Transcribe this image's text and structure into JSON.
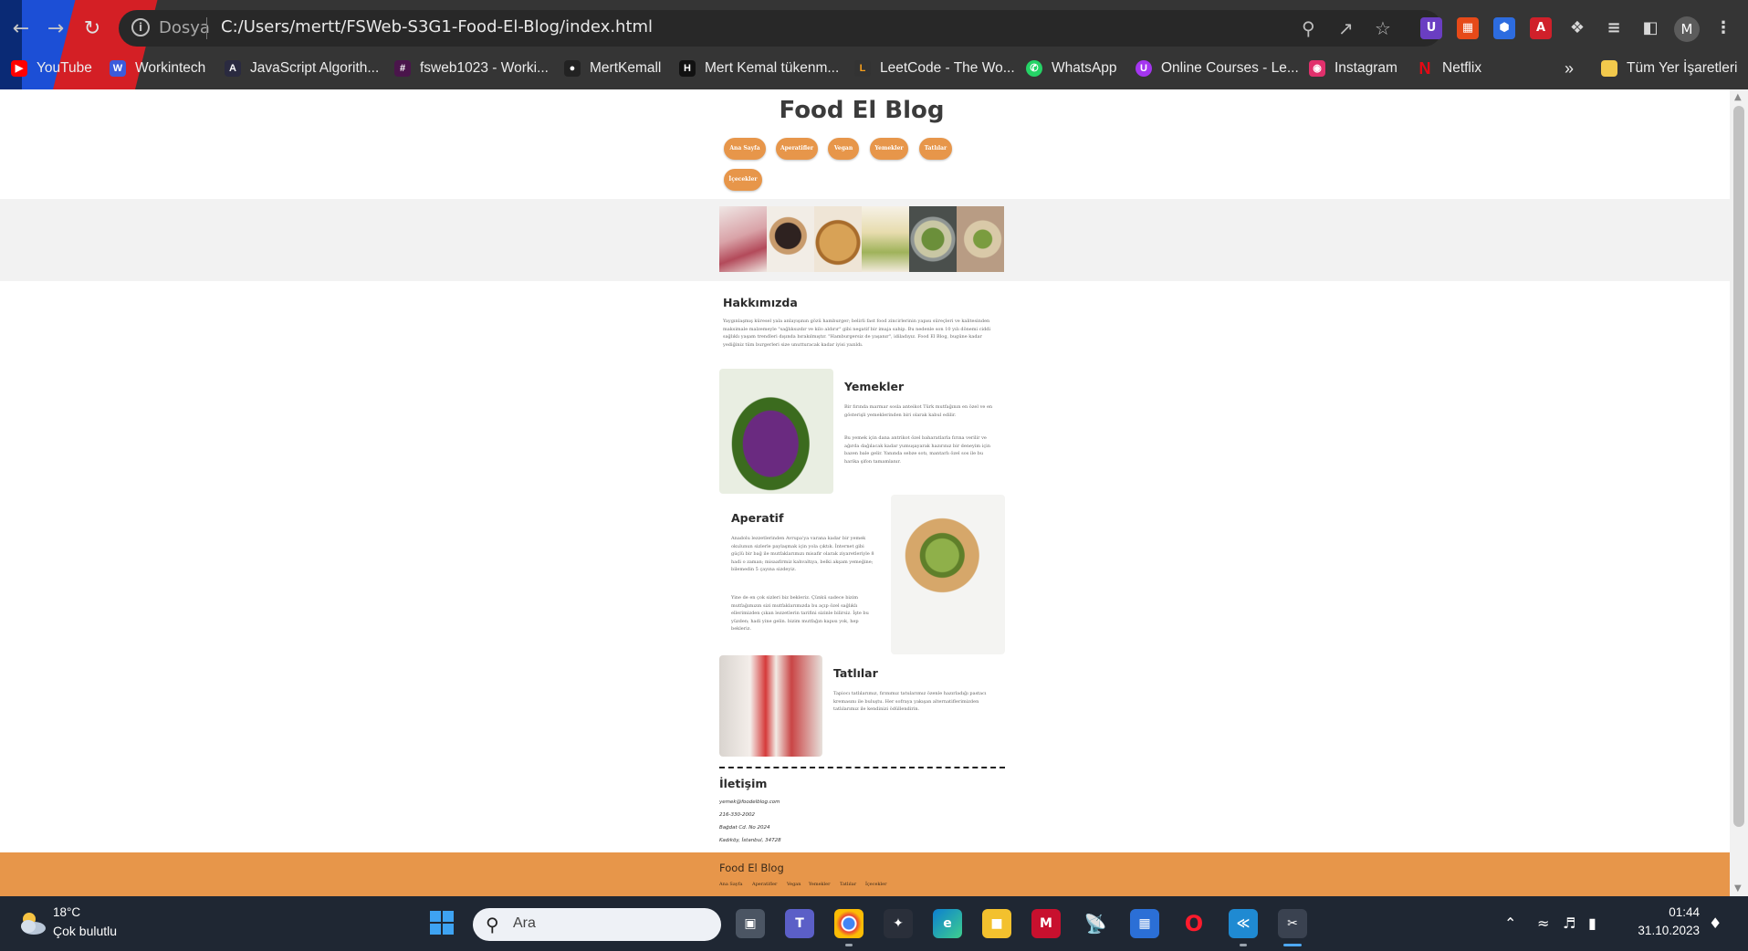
{
  "browser": {
    "site_info_label": "Dosya",
    "url": "C:/Users/mertt/FSWeb-S3G1-Food-El-Blog/index.html",
    "profile_initial": "M",
    "bookmarks": [
      {
        "label": "YouTube",
        "icon": "youtube-icon",
        "color": "#ff0000"
      },
      {
        "label": "Workintech",
        "icon": "workintech-icon",
        "color": "#3b5bdb"
      },
      {
        "label": "JavaScript Algorith...",
        "icon": "freecodecamp-icon",
        "color": "#2a2a40"
      },
      {
        "label": "fsweb1023 - Worki...",
        "icon": "slack-icon",
        "color": "#4a154b"
      },
      {
        "label": "MertKemall",
        "icon": "github-icon",
        "color": "#222222"
      },
      {
        "label": "Mert Kemal tükenm...",
        "icon": "hackerrank-icon",
        "color": "#111111"
      },
      {
        "label": "LeetCode - The Wo...",
        "icon": "leetcode-icon",
        "color": "#333333"
      },
      {
        "label": "WhatsApp",
        "icon": "whatsapp-icon",
        "color": "#25d366"
      },
      {
        "label": "Online Courses - Le...",
        "icon": "udemy-icon",
        "color": "#a435f0"
      },
      {
        "label": "Instagram",
        "icon": "instagram-icon",
        "color": "#e1306c"
      },
      {
        "label": "Netflix",
        "icon": "netflix-icon",
        "color": "#e50914"
      }
    ],
    "overflow": "»",
    "all_bookmarks": "Tüm Yer İşaretleri"
  },
  "site": {
    "title": "Food El Blog",
    "nav": [
      "Ana Sayfa",
      "Aperatifler",
      "Vegan",
      "Yemekler",
      "Tatlılar",
      "İçecekler"
    ],
    "about": {
      "heading": "Hakkımızda",
      "text": "Yaygınlaşmış küresel yala anlayışının gözü hamburger; belirli fast food zincirlerinin yapısı süreçleri ve kalitesinden maksimale malzemeyle \"sağlıksızdır ve kilo aldırır\" gibi negatif bir imaja sahip. Bu nedenle son 10 yılı dönemi ciddi sağlıklı yaşam trendleri dışında bırakılmıştır. \"Hamburgersiz de yaşanır\", idiladıyız. Food El Blog, bugüne kadar yediğiniz tüm burgerleri size unutturacak kadar iyisi yazıldı."
    },
    "yemekler": {
      "heading": "Yemekler",
      "p1": "Bir fırında marmar sosla anteikot Türk mutfağının en özel ve en gösterişli yemeklerinden biri olarak kabul edilir.",
      "p2": "Bu yemek için dana antrikot özel baharatlarla fırına verilir ve ağırda dağılacak kadar yumuşayarak hazırınız bir deneyim için bazen bale gelir. Yanında sebze sotı, mantarlı özel sos ile bu harika şifon tamamlanır."
    },
    "aperatif": {
      "heading": "Aperatif",
      "p1": "Anadolu lezzetlerinden Avrupa'ya varana kadar bir yemek okulunun sizlerle paylaşmak için yola çıktık. İnternet gibi güçlü bir bağ ile mutfaklarımızı misafir olarak ziyaretleriyle 8 hadi o zaman; misaafirmiz kahvaltıya, belki akşam yemeğine; bilemedin 5 çayına sizdeyiz.",
      "p2": "Yine de en çok sizleri biz bekleriz. Çünkü sadece bizim mutfağımızın sizi mutfaklarımızda bu açıp özel sağlıklı ellerimizden çıkan lezzetlerin tarifini sizinle bilirsiz. İşte bu yüzden; hadi yine gelin. bizim mutfağın kapısı yok, hep bekleriz."
    },
    "tatlilar": {
      "heading": "Tatlılar",
      "p1": "Tapiocı tatlılarımız, fırınımız tatularımız özenle hazırladığı pastacı kremasını ile buluştu. Her sofraya yakışan alternatiflerimizden tatlılarımız ile kendinizi ödüllendirin."
    },
    "contact": {
      "heading": "İletişim",
      "email": "yemek@foodelblog.com",
      "phone": "216-330-2002",
      "street": "Bağdat Cd. No 2024",
      "city": "Kadıköy, İstanbul, 34728"
    },
    "footer": {
      "title": "Food El Blog",
      "links": [
        "Ana Sayfa",
        "Aperatifler",
        "Vegan",
        "Yemekler",
        "Tatlılar",
        "İçecekler"
      ]
    }
  },
  "taskbar": {
    "temperature": "18°C",
    "weather": "Çok bulutlu",
    "search_placeholder": "Ara",
    "time": "01:44",
    "date": "31.10.2023"
  },
  "colors": {
    "accent": "#e7964a",
    "banner": "#f2f2f2",
    "chrome": "#353535",
    "taskbar": "#1f2733"
  }
}
